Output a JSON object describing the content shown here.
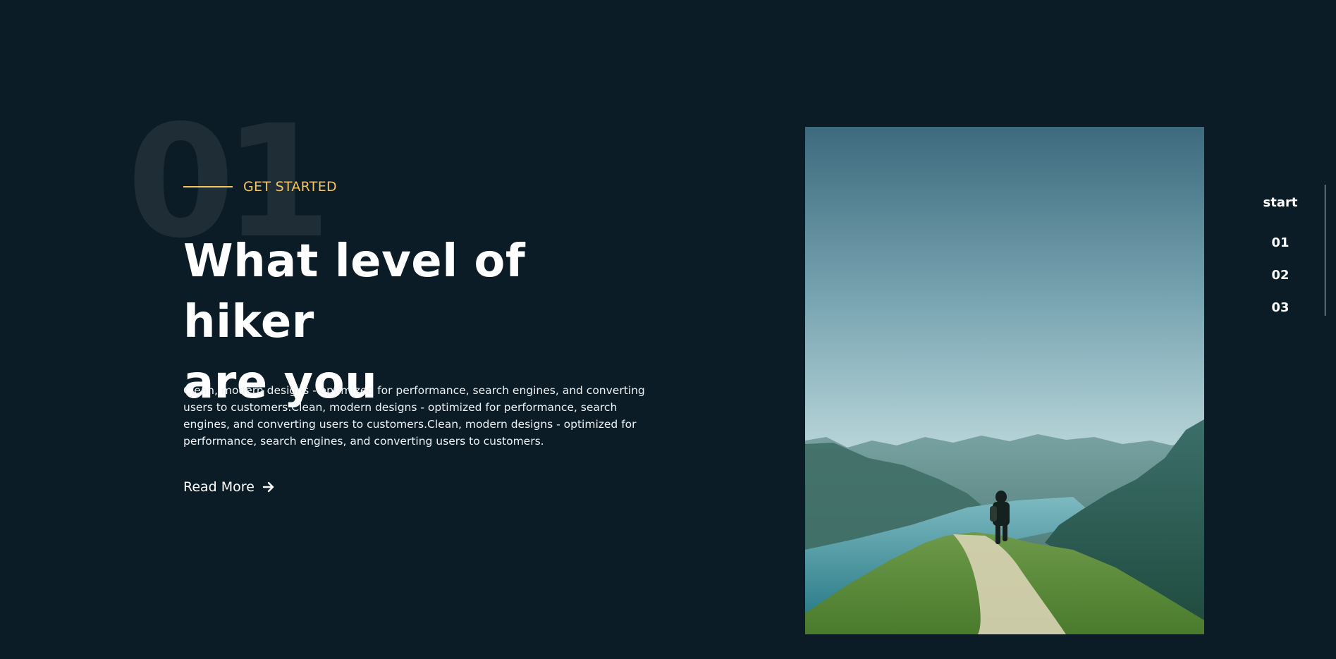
{
  "hero": {
    "background_number": "01",
    "eyebrow": "GET STARTED",
    "headline_line1": "What level of hiker",
    "headline_line2": "are you",
    "description": "Clean, modern designs - optimized for performance, search engines, and converting users to customers.Clean, modern designs - optimized for performance, search engines, and converting users to customers.Clean, modern designs - optimized for performance, search engines, and converting users to customers.",
    "read_more_label": "Read More",
    "image_alt_icon": "mountain-hiker-photo"
  },
  "side_nav": {
    "items": [
      "start",
      "01",
      "02",
      "03"
    ]
  },
  "colors": {
    "background": "#0b1c26",
    "accent": "#f2c462",
    "text": "#ffffff",
    "bg_number": "#1e2d36"
  }
}
